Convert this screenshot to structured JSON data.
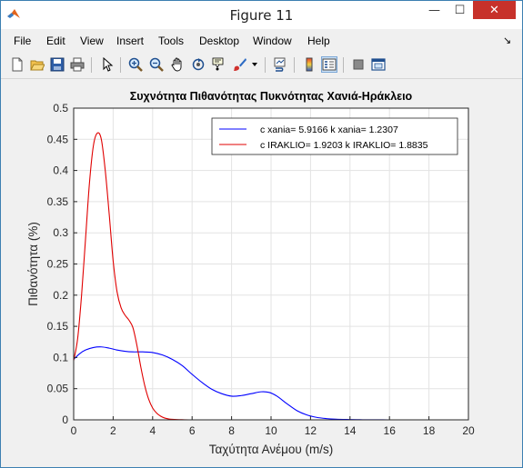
{
  "window": {
    "title": "Figure 11",
    "minimize_glyph": "—",
    "maximize_glyph": "☐",
    "close_glyph": "✕"
  },
  "menu": {
    "items": [
      "File",
      "Edit",
      "View",
      "Insert",
      "Tools",
      "Desktop",
      "Window",
      "Help"
    ],
    "overflow_glyph": "↘"
  },
  "toolbar": {
    "icons": [
      "new-figure-icon",
      "open-file-icon",
      "save-icon",
      "print-icon",
      "edit-plot-arrow-icon",
      "zoom-in-icon",
      "zoom-out-icon",
      "pan-hand-icon",
      "rotate-3d-icon",
      "data-cursor-icon",
      "brush-icon",
      "brush-dropdown-icon",
      "link-plot-icon",
      "insert-colorbar-icon",
      "insert-legend-icon",
      "hide-plot-tools-icon",
      "show-plot-tools-icon"
    ]
  },
  "colors": {
    "series1": "#0000ff",
    "series2": "#e00000",
    "grid": "#e3e3e3",
    "axes": "#262626",
    "close_button": "#c7312a"
  },
  "chart_data": {
    "type": "line",
    "title": "Συχνότητα Πιθανότητας Πυκνότητας Χανιά-Ηράκλειο",
    "xlabel": "Ταχύτητα Ανέμου (m/s)",
    "ylabel": "Πιθανότητα (%)",
    "xlim": [
      0,
      20
    ],
    "ylim": [
      0,
      0.5
    ],
    "xticks": [
      "0",
      "2",
      "4",
      "6",
      "8",
      "10",
      "12",
      "14",
      "16",
      "18",
      "20"
    ],
    "yticks": [
      "0",
      "0.05",
      "0.1",
      "0.15",
      "0.2",
      "0.25",
      "0.3",
      "0.35",
      "0.4",
      "0.45",
      "0.5"
    ],
    "grid": true,
    "legend_position": "top-right",
    "series": [
      {
        "name": "c xania= 5.9166 k xania= 1.2307",
        "color": "#0000ff",
        "x": [
          0,
          0.3,
          0.6,
          1.0,
          1.4,
          1.8,
          2.2,
          2.6,
          3.0,
          3.5,
          4.0,
          4.5,
          5.0,
          5.5,
          6.0,
          6.5,
          7.0,
          7.5,
          8.0,
          8.5,
          9.0,
          9.5,
          9.9,
          10.3,
          10.8,
          11.3,
          11.8,
          12.3,
          12.8,
          13.3,
          14.0,
          14.5,
          15,
          16,
          17,
          18,
          19,
          20
        ],
        "y": [
          0.097,
          0.106,
          0.112,
          0.116,
          0.117,
          0.115,
          0.112,
          0.11,
          0.109,
          0.109,
          0.108,
          0.104,
          0.097,
          0.087,
          0.073,
          0.06,
          0.049,
          0.042,
          0.038,
          0.039,
          0.042,
          0.045,
          0.044,
          0.038,
          0.026,
          0.015,
          0.008,
          0.004,
          0.002,
          0.001,
          0.0005,
          0.0002,
          0.0001,
          0,
          0,
          0,
          0,
          0
        ]
      },
      {
        "name": "c IRAKLIO= 1.9203 k IRAKLIO= 1.8835",
        "color": "#e00000",
        "x": [
          0,
          0.2,
          0.4,
          0.6,
          0.8,
          1.0,
          1.2,
          1.4,
          1.6,
          1.8,
          2.0,
          2.2,
          2.4,
          2.6,
          2.8,
          3.0,
          3.2,
          3.4,
          3.6,
          3.8,
          4.0,
          4.2,
          4.4,
          4.6,
          4.8,
          5.0,
          5.5,
          6,
          8,
          10,
          12,
          14,
          16,
          18,
          20
        ],
        "y": [
          0.095,
          0.13,
          0.2,
          0.29,
          0.38,
          0.44,
          0.46,
          0.45,
          0.4,
          0.33,
          0.255,
          0.205,
          0.18,
          0.168,
          0.16,
          0.148,
          0.12,
          0.085,
          0.055,
          0.033,
          0.019,
          0.011,
          0.006,
          0.003,
          0.0015,
          0.0008,
          0.0002,
          0,
          0,
          0,
          0,
          0,
          0,
          0,
          0
        ]
      }
    ]
  }
}
